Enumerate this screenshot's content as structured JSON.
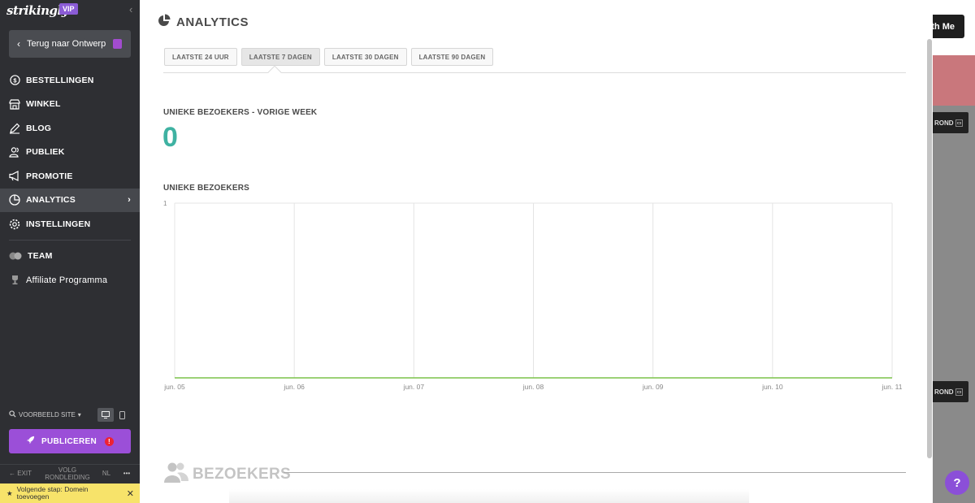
{
  "sidebar": {
    "logo": "strikingly",
    "badge": "VIP",
    "back_label": "Terug naar Ontwerp",
    "items": [
      {
        "label": "BESTELLINGEN",
        "icon": "dollar-circle-icon"
      },
      {
        "label": "WINKEL",
        "icon": "store-icon"
      },
      {
        "label": "BLOG",
        "icon": "pen-icon"
      },
      {
        "label": "PUBLIEK",
        "icon": "people-icon"
      },
      {
        "label": "PROMOTIE",
        "icon": "megaphone-icon"
      },
      {
        "label": "ANALYTICS",
        "icon": "pie-chart-icon",
        "active": true
      },
      {
        "label": "INSTELLINGEN",
        "icon": "gear-icon"
      }
    ],
    "team_label": "TEAM",
    "affiliate_label": "Affiliate Programma",
    "preview_label": "VOORBEELD SITE",
    "publish_label": "PUBLICEREN",
    "footer": {
      "exit": "EXIT",
      "tour_line1": "VOLG",
      "tour_line2": "RONDLEIDING",
      "lang": "NL",
      "more": "•••"
    },
    "banner_line1": "Volgende stap: Domein",
    "banner_line2": "toevoegen"
  },
  "background_site": {
    "button_label": "th Me",
    "bar_label": "ROND"
  },
  "panel": {
    "title": "ANALYTICS",
    "tabs": [
      "LAATSTE 24 UUR",
      "LAATSTE 7 DAGEN",
      "LAATSTE 30 DAGEN",
      "LAATSTE 90 DAGEN"
    ],
    "active_tab": 1,
    "stat_label": "UNIEKE BEZOEKERS - VORIGE WEEK",
    "stat_value": "0",
    "chart_label": "UNIEKE BEZOEKERS",
    "next_section": "BEZOEKERS"
  },
  "chart_data": {
    "type": "line",
    "categories": [
      "jun. 05",
      "jun. 06",
      "jun. 07",
      "jun. 08",
      "jun. 09",
      "jun. 10",
      "jun. 11"
    ],
    "series": [
      {
        "values": [
          0,
          0,
          0,
          0,
          0,
          0,
          0
        ],
        "color": "#7cc24a"
      }
    ],
    "yticks": [
      "1"
    ],
    "ylim": [
      0,
      1
    ],
    "grid": true
  },
  "colors": {
    "accent": "#9b4fd8",
    "stat": "#3fb2a2",
    "sidebar": "#2e2f33"
  }
}
